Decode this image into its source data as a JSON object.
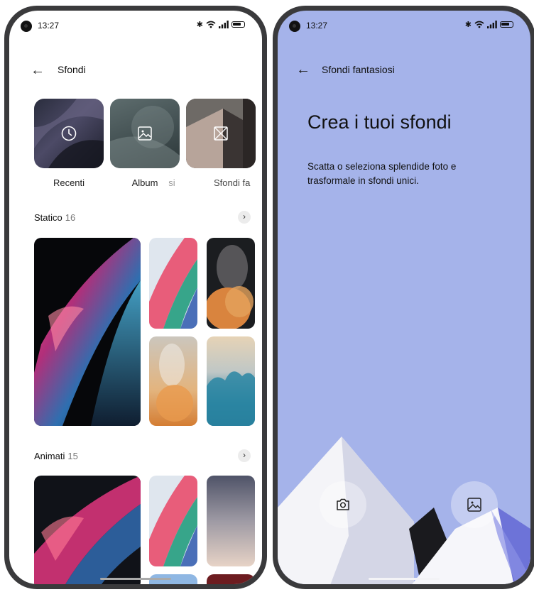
{
  "left_phone": {
    "status": {
      "time": "13:27"
    },
    "header": {
      "title": "Sfondi"
    },
    "categories": [
      {
        "label": "Recenti",
        "icon": "clock-icon"
      },
      {
        "label": "Album",
        "icon": "image-icon"
      },
      {
        "label": "si"
      },
      {
        "label": "Sfondi fa",
        "icon": "wallpaper-icon"
      }
    ],
    "sections": [
      {
        "title": "Statico",
        "count": "16"
      },
      {
        "title": "Animati",
        "count": "15"
      }
    ]
  },
  "right_phone": {
    "status": {
      "time": "13:27"
    },
    "header": {
      "title": "Sfondi fantasiosi"
    },
    "heading": "Crea i tuoi sfondi",
    "description": "Scatta o seleziona splendide foto e trasformale in sfondi unici.",
    "actions": [
      {
        "icon": "camera-icon"
      },
      {
        "icon": "image-icon"
      }
    ]
  },
  "colors": {
    "fantasy_background": "#a5b3ea",
    "frame": "#3a3a3c"
  }
}
